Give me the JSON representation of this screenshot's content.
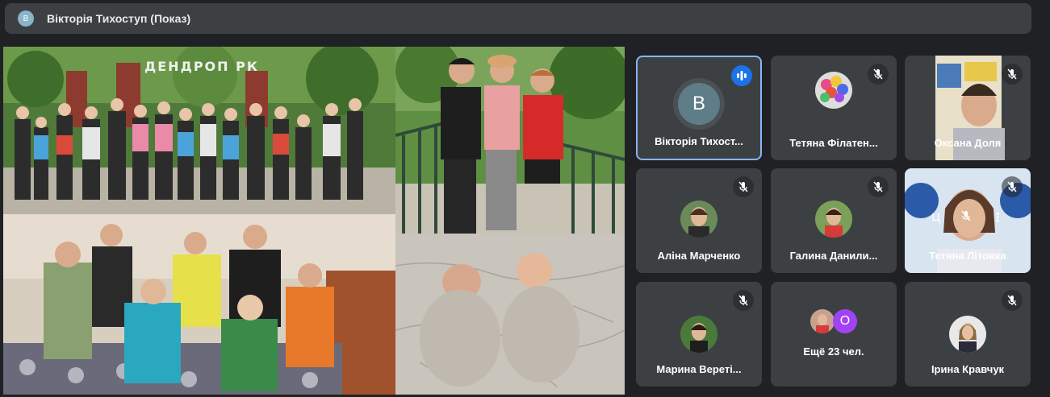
{
  "presenter": {
    "badge_letter": "B",
    "title": "Вікторія Тихоступ (Показ)"
  },
  "presentation": {
    "photo_sign_text": "ДЕНДРОП РК"
  },
  "participants": [
    {
      "name": "Вікторія Тихост...",
      "avatar_letter": "B",
      "state": "speaking"
    },
    {
      "name": "Тетяна Філатен...",
      "state": "muted"
    },
    {
      "name": "Оксана Доля",
      "state": "muted"
    },
    {
      "name": "Аліна Марченко",
      "state": "muted"
    },
    {
      "name": "Галина Данили...",
      "state": "muted"
    },
    {
      "name": "Тетяна Літовка",
      "state": "muted"
    },
    {
      "name": "Марина Вереті...",
      "state": "muted"
    },
    {
      "name": "Ещё 23 чел.",
      "extra_letter": "O",
      "state": "none"
    },
    {
      "name": "Ірина Кравчук",
      "state": "muted"
    }
  ],
  "tile_controls": {
    "pin_glyph": "Ц",
    "more_glyph": "⋮"
  },
  "colors": {
    "background": "#202124",
    "tile": "#3c4043",
    "active_border": "#8ab4f8",
    "speaking": "#1a73e8",
    "extra_avatar": "#a142f4"
  }
}
